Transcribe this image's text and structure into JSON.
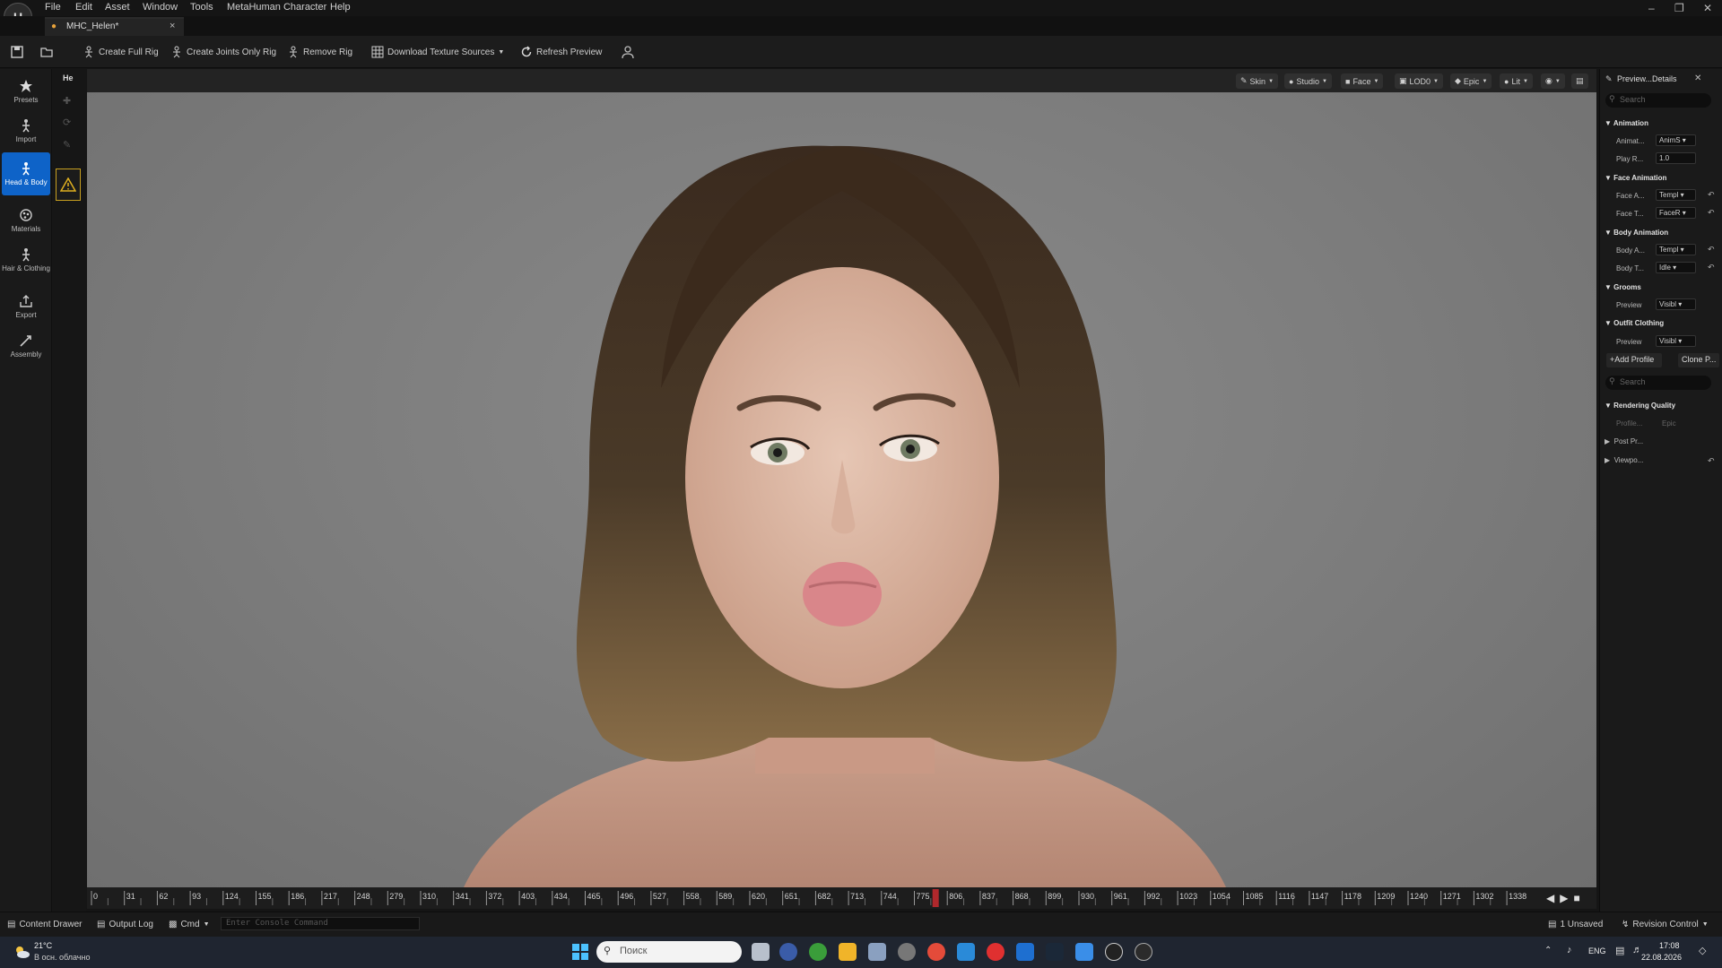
{
  "menu": [
    "File",
    "Edit",
    "Asset",
    "Window",
    "Tools",
    "MetaHuman Character",
    "Help"
  ],
  "tab": {
    "title": "MHC_Helen*",
    "close": "×"
  },
  "toolbar": {
    "create_full_rig": "Create Full Rig",
    "create_joints_only_rig": "Create Joints Only Rig",
    "remove_rig": "Remove Rig",
    "download_texture_sources": "Download Texture Sources",
    "refresh_preview": "Refresh Preview"
  },
  "leftbar": [
    {
      "label": "Presets",
      "icon": "star-icon"
    },
    {
      "label": "Import",
      "icon": "import-icon"
    },
    {
      "label": "Head & Body",
      "icon": "body-icon"
    },
    {
      "label": "Materials",
      "icon": "materials-icon"
    },
    {
      "label": "Hair & Clothing",
      "icon": "hair-icon"
    },
    {
      "label": "Export",
      "icon": "export-icon"
    },
    {
      "label": "Assembly",
      "icon": "assembly-icon"
    }
  ],
  "toolcol": {
    "tab": "He"
  },
  "viewport_bar": [
    "Skin",
    "Studio",
    "Face",
    "LOD0",
    "Epic",
    "Lit"
  ],
  "timeline": {
    "ticks": [
      "0",
      "31",
      "62",
      "93",
      "124",
      "155",
      "186",
      "217",
      "248",
      "279",
      "310",
      "341",
      "372",
      "403",
      "434",
      "465",
      "496",
      "527",
      "558",
      "589",
      "620",
      "651",
      "682",
      "713",
      "744",
      "775",
      "806",
      "837",
      "868",
      "899",
      "930",
      "961",
      "992",
      "1023",
      "1054",
      "1085",
      "1116",
      "1147",
      "1178",
      "1209",
      "1240",
      "1271",
      "1302",
      "1338"
    ],
    "playhead_frame": "775"
  },
  "details": {
    "title": "Preview...Details",
    "search_placeholder": "Search",
    "animation_header": "Animation",
    "animation_label": "Animat...",
    "animation_value": "AnimS",
    "play_rate_label": "Play R...",
    "play_rate_value": "1.0",
    "face_animation_header": "Face Animation",
    "face_a_label": "Face A...",
    "face_a_value": "Templ",
    "face_t_label": "Face T...",
    "face_t_value": "FaceR",
    "body_animation_header": "Body Animation",
    "body_a_label": "Body A...",
    "body_a_value": "Templ",
    "body_t_label": "Body T...",
    "body_t_value": "Idle",
    "grooms_header": "Grooms",
    "grooms_preview_label": "Preview",
    "grooms_preview_value": "Visibl",
    "outfit_header": "Outfit Clothing",
    "outfit_preview_label": "Preview",
    "outfit_preview_value": "Visibl",
    "add_profile": "+Add Profile",
    "clone_profile": "Clone P...",
    "search2_placeholder": "Search",
    "rendering_header": "Rendering Quality",
    "profile_label": "Profile...",
    "profile_value": "Epic",
    "post_label": "Post Pr...",
    "viewport_label": "Viewpo..."
  },
  "statusbar": {
    "content_drawer": "Content Drawer",
    "output_log": "Output Log",
    "cmd": "Cmd",
    "console_placeholder": "Enter Console Command",
    "unsaved": "1 Unsaved",
    "revision": "Revision Control"
  },
  "taskbar": {
    "weather_temp": "21°C",
    "weather_desc": "В осн. облачно",
    "search": "Поиск",
    "lang": "ENG",
    "time": "17:08",
    "date": "22.08.2026"
  }
}
